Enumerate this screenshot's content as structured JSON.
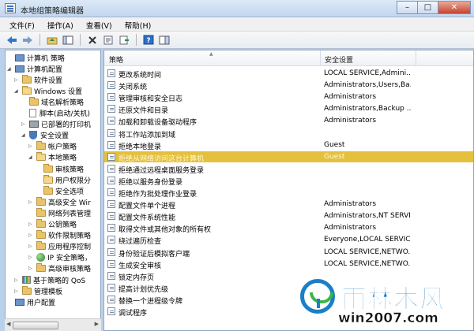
{
  "window": {
    "title": "本地组策略编辑器",
    "minimize": "–",
    "maximize": "□",
    "close": "✕"
  },
  "menu": [
    "文件(F)",
    "操作(A)",
    "查看(V)",
    "帮助(H)"
  ],
  "tree": [
    {
      "label": "计算机 策略",
      "icon": "computer-icon",
      "depth": 0,
      "expander": "",
      "truncated": true
    },
    {
      "label": "计算机配置",
      "icon": "computer-icon",
      "depth": 0,
      "expander": "◢"
    },
    {
      "label": "软件设置",
      "icon": "folder-icon",
      "depth": 1,
      "expander": "▷"
    },
    {
      "label": "Windows 设置",
      "icon": "folder-open-icon",
      "depth": 1,
      "expander": "◢"
    },
    {
      "label": "域名解析策略",
      "icon": "folder-icon",
      "depth": 2,
      "expander": ""
    },
    {
      "label": "脚本(启动/关机)",
      "icon": "document-icon",
      "depth": 2,
      "expander": ""
    },
    {
      "label": "已部署的打印机",
      "icon": "printer-icon",
      "depth": 2,
      "expander": "▷"
    },
    {
      "label": "安全设置",
      "icon": "shield-icon",
      "depth": 2,
      "expander": "◢"
    },
    {
      "label": "帐户策略",
      "icon": "folder-icon",
      "depth": 3,
      "expander": "▷"
    },
    {
      "label": "本地策略",
      "icon": "folder-open-icon",
      "depth": 3,
      "expander": "◢"
    },
    {
      "label": "审核策略",
      "icon": "folder-icon",
      "depth": 4,
      "expander": ""
    },
    {
      "label": "用户权限分",
      "icon": "folder-open-icon",
      "depth": 4,
      "expander": ""
    },
    {
      "label": "安全选项",
      "icon": "folder-icon",
      "depth": 4,
      "expander": ""
    },
    {
      "label": "高级安全 Wir",
      "icon": "folder-icon",
      "depth": 3,
      "expander": "▷"
    },
    {
      "label": "网络列表管理",
      "icon": "folder-icon",
      "depth": 3,
      "expander": ""
    },
    {
      "label": "公钥策略",
      "icon": "folder-icon",
      "depth": 3,
      "expander": "▷"
    },
    {
      "label": "软件限制策略",
      "icon": "folder-icon",
      "depth": 3,
      "expander": "▷"
    },
    {
      "label": "应用程序控制",
      "icon": "folder-icon",
      "depth": 3,
      "expander": "▷"
    },
    {
      "label": "IP 安全策略，",
      "icon": "globe-icon",
      "depth": 3,
      "expander": "▷"
    },
    {
      "label": "高级审核策略",
      "icon": "folder-icon",
      "depth": 3,
      "expander": "▷"
    },
    {
      "label": "基于策略的 QoS",
      "icon": "chart-icon",
      "depth": 1,
      "expander": "▷"
    },
    {
      "label": "管理模板",
      "icon": "folder-icon",
      "depth": 1,
      "expander": "▷"
    },
    {
      "label": "用户配置",
      "icon": "computer-icon",
      "depth": 0,
      "expander": ""
    }
  ],
  "list": {
    "columns": {
      "policy": "策略",
      "setting": "安全设置"
    },
    "rows": [
      {
        "policy": "更改系统时间",
        "setting": "LOCAL SERVICE,Admini..."
      },
      {
        "policy": "关闭系统",
        "setting": "Administrators,Users,Ba..."
      },
      {
        "policy": "管理审核和安全日志",
        "setting": "Administrators"
      },
      {
        "policy": "还原文件和目录",
        "setting": "Administrators,Backup ..."
      },
      {
        "policy": "加载和卸载设备驱动程序",
        "setting": "Administrators"
      },
      {
        "policy": "将工作站添加到域",
        "setting": ""
      },
      {
        "policy": "拒绝本地登录",
        "setting": "Guest"
      },
      {
        "policy": "拒绝从网络访问这台计算机",
        "setting": "Guest",
        "selected": true
      },
      {
        "policy": "拒绝通过远程桌面服务登录",
        "setting": ""
      },
      {
        "policy": "拒绝以服务身份登录",
        "setting": ""
      },
      {
        "policy": "拒绝作为批处理作业登录",
        "setting": ""
      },
      {
        "policy": "配置文件单个进程",
        "setting": "Administrators"
      },
      {
        "policy": "配置文件系统性能",
        "setting": "Administrators,NT SERVI..."
      },
      {
        "policy": "取得文件或其他对象的所有权",
        "setting": "Administrators"
      },
      {
        "policy": "绕过遍历检查",
        "setting": "Everyone,LOCAL SERVICE..."
      },
      {
        "policy": "身份验证后模拟客户端",
        "setting": "LOCAL SERVICE,NETWO..."
      },
      {
        "policy": "生成安全审核",
        "setting": "LOCAL SERVICE,NETWO..."
      },
      {
        "policy": "锁定内存页",
        "setting": ""
      },
      {
        "policy": "提高计划优先级",
        "setting": ""
      },
      {
        "policy": "替换一个进程级令牌",
        "setting": ""
      },
      {
        "policy": "调试程序",
        "setting": ""
      }
    ]
  },
  "watermark": {
    "brand": "雨林木风",
    "url": "win2007.com"
  },
  "colors": {
    "selection": "#e4c03c",
    "accent": "#1a7fc6",
    "logo_green": "#3ab54a"
  }
}
